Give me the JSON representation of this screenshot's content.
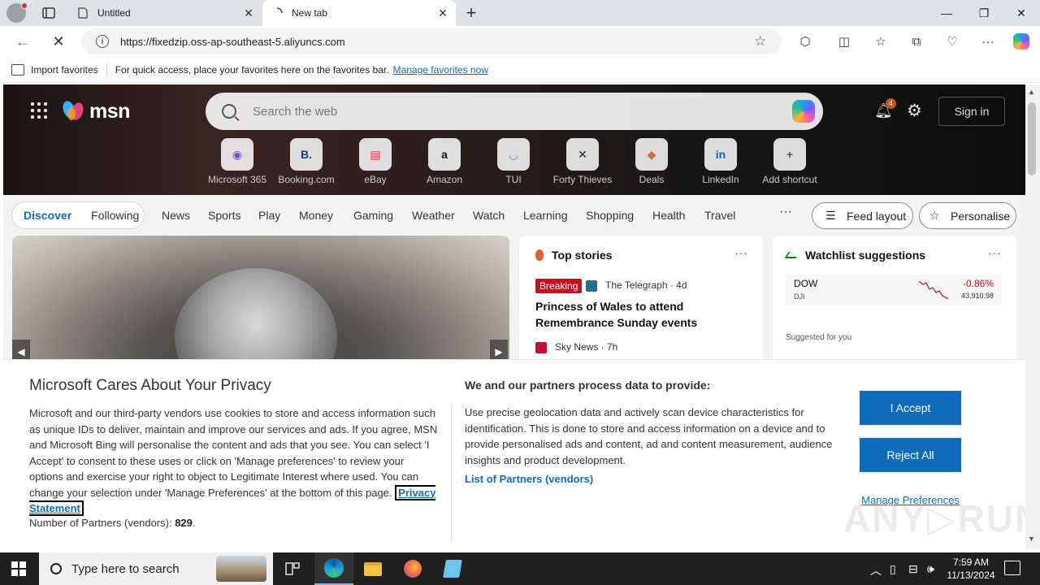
{
  "browser": {
    "tabs": [
      {
        "label": "Untitled",
        "favicon": "page-icon"
      },
      {
        "label": "New tab",
        "favicon": "loading-icon"
      }
    ],
    "url": "https://fixedzip.oss-ap-southeast-5.aliyuncs.com",
    "favorites_bar": {
      "import_label": "Import favorites",
      "hint": "For quick access, place your favorites here on the favorites bar.",
      "manage_link": "Manage favorites now"
    }
  },
  "msn": {
    "logo_text": "msn",
    "search_placeholder": "Search the web",
    "notifications_count": "4",
    "sign_in": "Sign in",
    "shortcuts": [
      {
        "label": "Microsoft 365",
        "tile": "◉",
        "color": "#6b4fd8"
      },
      {
        "label": "Booking.com",
        "tile": "B.",
        "color": "#1a3a8f"
      },
      {
        "label": "eBay",
        "tile": "▤",
        "color": "#e53238"
      },
      {
        "label": "Amazon",
        "tile": "a",
        "color": "#111111"
      },
      {
        "label": "TUI",
        "tile": "◡",
        "color": "#1a9fe0"
      },
      {
        "label": "Forty Thieves",
        "tile": "✕",
        "color": "#222222"
      },
      {
        "label": "Deals",
        "tile": "◆",
        "color": "#d86a2a"
      },
      {
        "label": "LinkedIn",
        "tile": "in",
        "color": "#0a66c2"
      },
      {
        "label": "Add shortcut",
        "tile": "+",
        "color": "#555555"
      }
    ],
    "nav": {
      "discover": "Discover",
      "following": "Following",
      "links": [
        "News",
        "Sports",
        "Play",
        "Money",
        "Gaming",
        "Weather",
        "Watch",
        "Learning",
        "Shopping",
        "Health",
        "Travel"
      ],
      "more": "···",
      "feed_layout": "Feed layout",
      "personalise": "Personalise"
    },
    "top_stories": {
      "title": "Top stories",
      "badge": "Breaking",
      "source1": "The Telegraph · 4d",
      "headline1": "Princess of Wales to attend Remembrance Sunday events",
      "source2": "Sky News · 7h"
    },
    "watchlist": {
      "title": "Watchlist suggestions",
      "symbol": "DOW",
      "sub": "DJI",
      "change": "-0.86%",
      "value": "43,910.98",
      "suggested": "Suggested for you"
    }
  },
  "privacy": {
    "title": "Microsoft Cares About Your Privacy",
    "body": "Microsoft and our third-party vendors use cookies to store and access information such as unique IDs to deliver, maintain and improve our services and ads. If you agree, MSN and Microsoft Bing will personalise the content and ads that you see. You can select 'I Accept' to consent to these uses or click on 'Manage preferences' to review your options and exercise your right to object to Legitimate Interest where used.  You can change your selection under 'Manage Preferences' at the bottom of this page.",
    "privacy_link": "Privacy Statement",
    "partners_label": "Number of Partners (vendors):",
    "partners_count": "829",
    "title2": "We and our partners process data to provide:",
    "body2": "Use precise geolocation data and actively scan device characteristics for identification. This is done to store and access information on a device and to provide personalised ads and content, ad and content measurement, audience insights and product development.",
    "partners_link": "List of Partners (vendors)",
    "accept": "I Accept",
    "reject": "Reject All",
    "manage": "Manage Preferences"
  },
  "taskbar": {
    "search_placeholder": "Type here to search",
    "time": "7:59 AM",
    "date": "11/13/2024"
  },
  "colors": {
    "accent": "#0f6cbd",
    "breaking": "#c50f1f",
    "taskbar": "#202020"
  }
}
